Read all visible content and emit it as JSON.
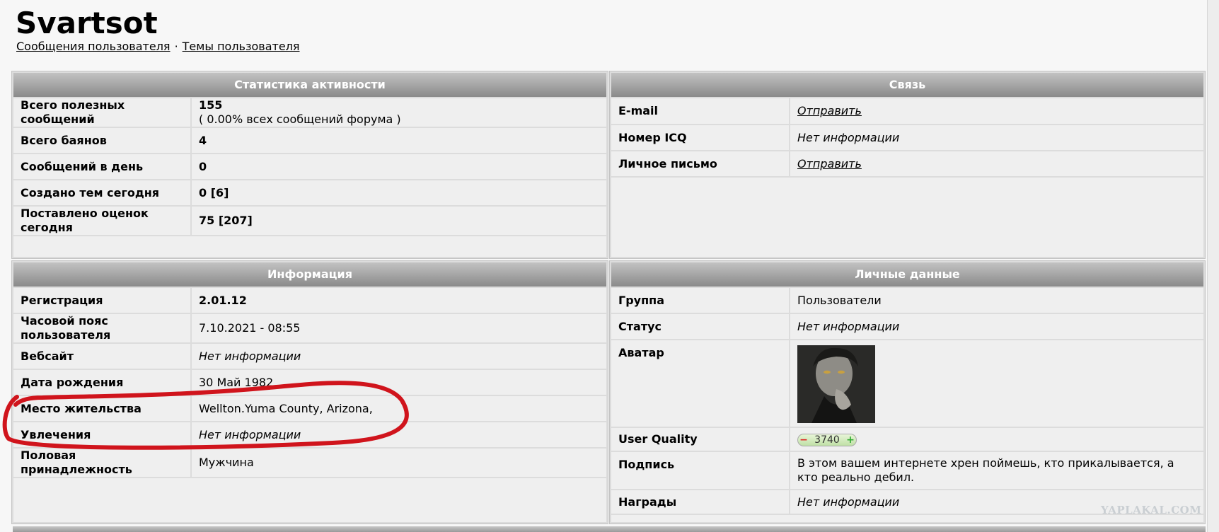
{
  "profile": {
    "username": "Svartsot",
    "links": {
      "posts": "Сообщения пользователя",
      "separator": "·",
      "topics": "Темы пользователя"
    }
  },
  "activity": {
    "title": "Статистика активности",
    "rows": [
      {
        "label": "Всего полезных сообщений",
        "value": "155",
        "sub": "( 0.00% всех сообщений форума )"
      },
      {
        "label": "Всего баянов",
        "value": "4"
      },
      {
        "label": "Сообщений в день",
        "value": "0"
      },
      {
        "label": "Создано тем сегодня",
        "value": "0 [6]"
      },
      {
        "label": "Поставлено оценок сегодня",
        "value": "75 [207]"
      }
    ]
  },
  "contact": {
    "title": "Связь",
    "rows": [
      {
        "label": "E-mail",
        "value": "Отправить"
      },
      {
        "label": "Номер ICQ",
        "value": "Нет информации"
      },
      {
        "label": "Личное письмо",
        "value": "Отправить"
      }
    ]
  },
  "info": {
    "title": "Информация",
    "rows": [
      {
        "label": "Регистрация",
        "value": "2.01.12"
      },
      {
        "label": "Часовой пояс пользователя",
        "value": "7.10.2021 - 08:55"
      },
      {
        "label": "Вебсайт",
        "value": "Нет информации"
      },
      {
        "label": "Дата рождения",
        "value": "30 Май 1982"
      },
      {
        "label": "Место жительства",
        "value": "Wellton.Yuma County, Arizona,"
      },
      {
        "label": "Увлечения",
        "value": "Нет информации"
      },
      {
        "label": "Половая принадлежность",
        "value": "Мужчина"
      }
    ]
  },
  "personal": {
    "title": "Личные данные",
    "rows": [
      {
        "label": "Группа",
        "value": "Пользователи"
      },
      {
        "label": "Статус",
        "value": "Нет информации"
      },
      {
        "label": "Аватар"
      },
      {
        "label": "User Quality",
        "minus": "−",
        "value": "3740",
        "plus": "+"
      },
      {
        "label": "Подпись",
        "value": "В этом вашем интернете хрен поймешь, кто прикалывается, а кто реально дебил."
      },
      {
        "label": "Награды",
        "value": "Нет информации"
      }
    ]
  },
  "watermark": "YAPLAKAL.COM",
  "colors": {
    "header_gradient_top": "#c2c2c2",
    "header_gradient_bottom": "#8a8a8a",
    "annotation_red": "#d0141c"
  }
}
